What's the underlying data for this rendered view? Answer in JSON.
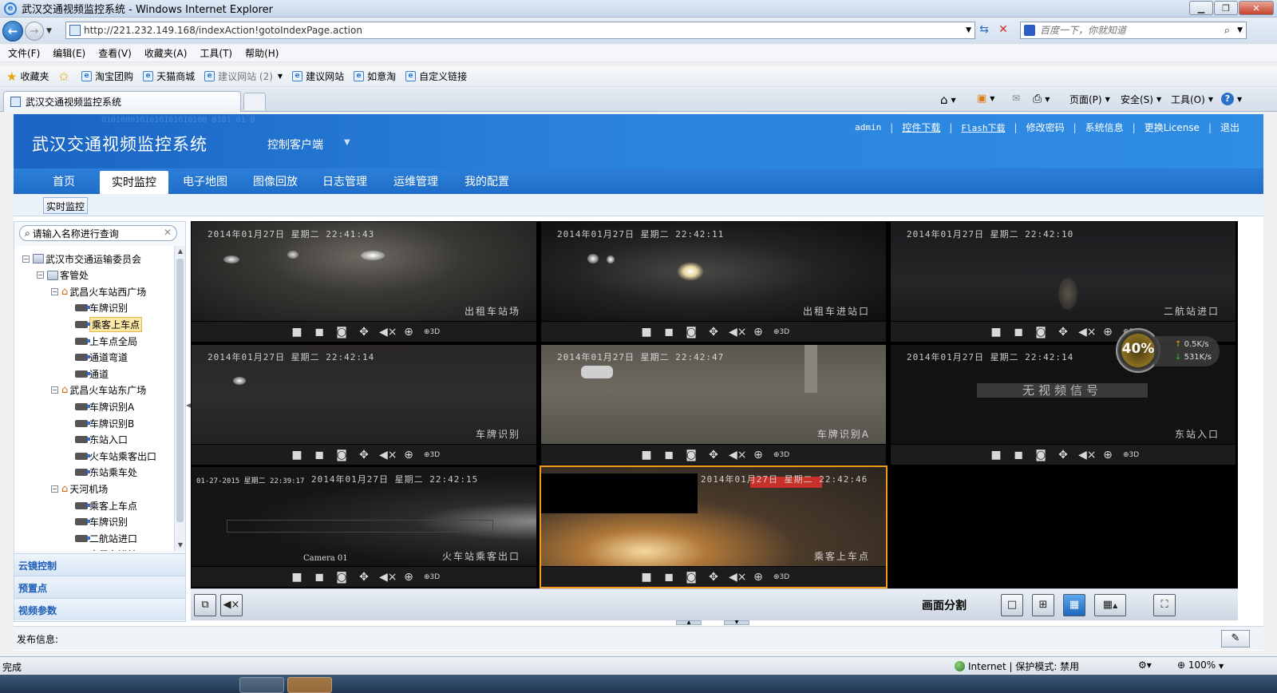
{
  "window": {
    "title": "武汉交通视频监控系统 - Windows Internet Explorer"
  },
  "address": {
    "url": "http://221.232.149.168/indexAction!gotoIndexPage.action",
    "search_placeholder": "百度一下，你就知道"
  },
  "menu": [
    "文件(F)",
    "编辑(E)",
    "查看(V)",
    "收藏夹(A)",
    "工具(T)",
    "帮助(H)"
  ],
  "favorites": {
    "label": "收藏夹",
    "items": [
      "淘宝团购",
      "天猫商城",
      "建议网站 (2)",
      "建议网站",
      "如意淘",
      "自定义链接"
    ]
  },
  "tab": {
    "title": "武汉交通视频监控系统"
  },
  "commands": {
    "page": "页面(P)",
    "safety": "安全(S)",
    "tools": "工具(O)"
  },
  "header": {
    "title": "武汉交通视频监控系统",
    "client": "控制客户端",
    "binary": "0101000101010101010100 0101 01 0",
    "links": [
      "admin",
      "控件下载",
      "Flash下载",
      "修改密码",
      "系统信息",
      "更换License",
      "退出"
    ]
  },
  "nav": {
    "items": [
      "首页",
      "实时监控",
      "电子地图",
      "图像回放",
      "日志管理",
      "运维管理",
      "我的配置"
    ],
    "active": "实时监控"
  },
  "subnav": {
    "button": "实时监控"
  },
  "tree": {
    "search_value": "请输入名称进行查询",
    "nodes": [
      {
        "label": "武汉市交通运输委员会",
        "type": "org",
        "level": 0,
        "toggle": "−"
      },
      {
        "label": "客管处",
        "type": "org",
        "level": 1,
        "toggle": "−"
      },
      {
        "label": "武昌火车站西广场",
        "type": "site",
        "level": 2,
        "toggle": "−"
      },
      {
        "label": "车牌识别",
        "type": "cam",
        "level": 3
      },
      {
        "label": "乘客上车点",
        "type": "cam",
        "level": 3,
        "selected": true
      },
      {
        "label": "上车点全局",
        "type": "cam",
        "level": 3
      },
      {
        "label": "通道弯道",
        "type": "cam",
        "level": 3
      },
      {
        "label": "通道",
        "type": "cam",
        "level": 3
      },
      {
        "label": "武昌火车站东广场",
        "type": "site",
        "level": 2,
        "toggle": "−"
      },
      {
        "label": "车牌识别A",
        "type": "cam",
        "level": 3
      },
      {
        "label": "车牌识别B",
        "type": "cam",
        "level": 3
      },
      {
        "label": "东站入口",
        "type": "cam",
        "level": 3
      },
      {
        "label": "火车站乘客出口",
        "type": "cam",
        "level": 3
      },
      {
        "label": "东站乘车处",
        "type": "cam",
        "level": 3
      },
      {
        "label": "天河机场",
        "type": "site",
        "level": 2,
        "toggle": "−"
      },
      {
        "label": "乘客上车点",
        "type": "cam",
        "level": 3
      },
      {
        "label": "车牌识别",
        "type": "cam",
        "level": 3
      },
      {
        "label": "二航站进口",
        "type": "cam",
        "level": 3
      },
      {
        "label": "出租车进站口",
        "type": "cam",
        "level": 3
      }
    ]
  },
  "accordion": [
    "云镜控制",
    "预置点",
    "视频参数"
  ],
  "cells": [
    {
      "osd": "2014年01月27日 星期二 22:41:43",
      "name": "出租车站场"
    },
    {
      "osd": "2014年01月27日 星期二 22:42:11",
      "name": "出租车进站口"
    },
    {
      "osd": "2014年01月27日 星期二 22:42:10",
      "name": "二航站进口"
    },
    {
      "osd": "2014年01月27日 星期二 22:42:14",
      "name": "车牌识别"
    },
    {
      "osd": "2014年01月27日 星期二 22:42:47",
      "name": "车牌识别A"
    },
    {
      "osd": "2014年01月27日 星期二 22:42:14",
      "name": "东站入口",
      "nosignal": "无视频信号"
    },
    {
      "osd": "2014年01月27日 星期二 22:42:15",
      "name": "火车站乘客出口",
      "stamp": "01-27-2015 星期二 22:39:17",
      "cam": "Camera 01"
    },
    {
      "osd": "2014年01月27日 星期二 22:42:46",
      "name": "乘客上车点",
      "selected": true
    },
    {
      "empty": true
    }
  ],
  "speed": {
    "percent": "40%",
    "up": "0.5K/s",
    "down": "531K/s"
  },
  "gridbar": {
    "split_label": "画面分割"
  },
  "publish": {
    "label": "发布信息:"
  },
  "status": {
    "text": "完成",
    "zone": "Internet | 保护模式: 禁用",
    "zoom": "100%"
  }
}
